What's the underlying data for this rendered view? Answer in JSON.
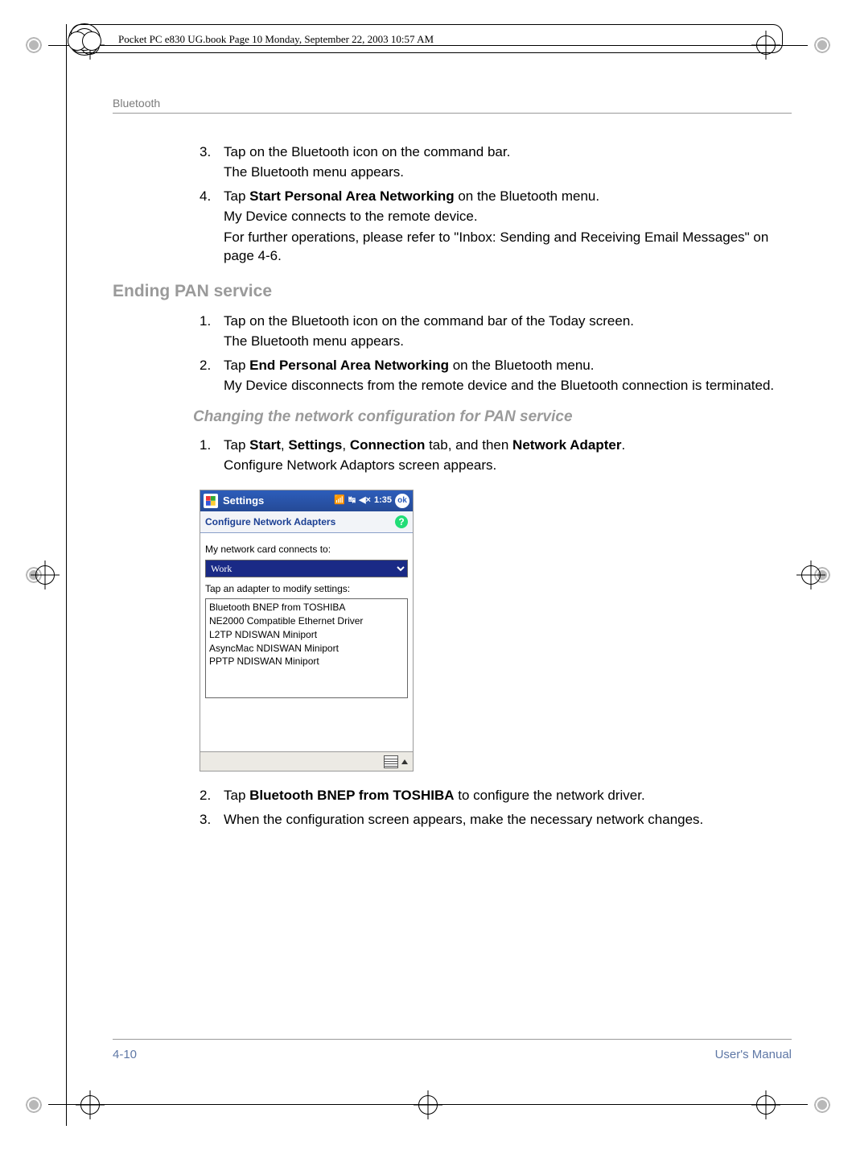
{
  "frame_meta": "Pocket PC e830 UG.book  Page 10  Monday, September 22, 2003  10:57 AM",
  "section_header": "Bluetooth",
  "step3": {
    "num": "3.",
    "l1": "Tap on the Bluetooth icon on the command bar.",
    "l2": "The Bluetooth menu appears."
  },
  "step4": {
    "num": "4.",
    "l1_pre": "Tap ",
    "l1_bold": "Start Personal Area Networking",
    "l1_post": " on the Bluetooth menu.",
    "l2": "My Device connects to the remote device.",
    "l3": "For further operations, please refer to \"Inbox: Sending and Receiving Email Messages\" on page 4-6."
  },
  "h_ending": "Ending PAN service",
  "end1": {
    "num": "1.",
    "l1": "Tap on the Bluetooth icon on the command bar of the Today screen.",
    "l2": "The Bluetooth menu appears."
  },
  "end2": {
    "num": "2.",
    "l1_pre": "Tap ",
    "l1_bold": "End Personal Area Networking",
    "l1_post": " on the Bluetooth menu.",
    "l2": "My Device disconnects from the remote device and the Bluetooth connection is terminated."
  },
  "h_changing": "Changing the network configuration for PAN service",
  "chg1": {
    "num": "1.",
    "pre": "Tap ",
    "b1": "Start",
    "s1": ", ",
    "b2": "Settings",
    "s2": ", ",
    "b3": "Connection",
    "s3": " tab, and then ",
    "b4": "Network Adapter",
    "post": ".",
    "l2": "Configure Network Adaptors screen appears."
  },
  "pda": {
    "title": "Settings",
    "time": "1:35",
    "ok": "ok",
    "subtitle": "Configure Network Adapters",
    "help": "?",
    "caption1": "My network card connects to:",
    "dropdown": "Work",
    "caption2": "Tap an adapter to modify settings:",
    "adapters": [
      "Bluetooth BNEP from TOSHIBA",
      "NE2000 Compatible Ethernet Driver",
      "L2TP NDISWAN Miniport",
      "AsyncMac NDISWAN Miniport",
      "PPTP NDISWAN Miniport"
    ]
  },
  "chg2": {
    "num": "2.",
    "pre": "Tap ",
    "bold": "Bluetooth BNEP from TOSHIBA",
    "post": " to configure the network driver."
  },
  "chg3": {
    "num": "3.",
    "text": "When the configuration screen appears, make the necessary network changes."
  },
  "footer": {
    "page": "4-10",
    "manual": "User's Manual"
  }
}
